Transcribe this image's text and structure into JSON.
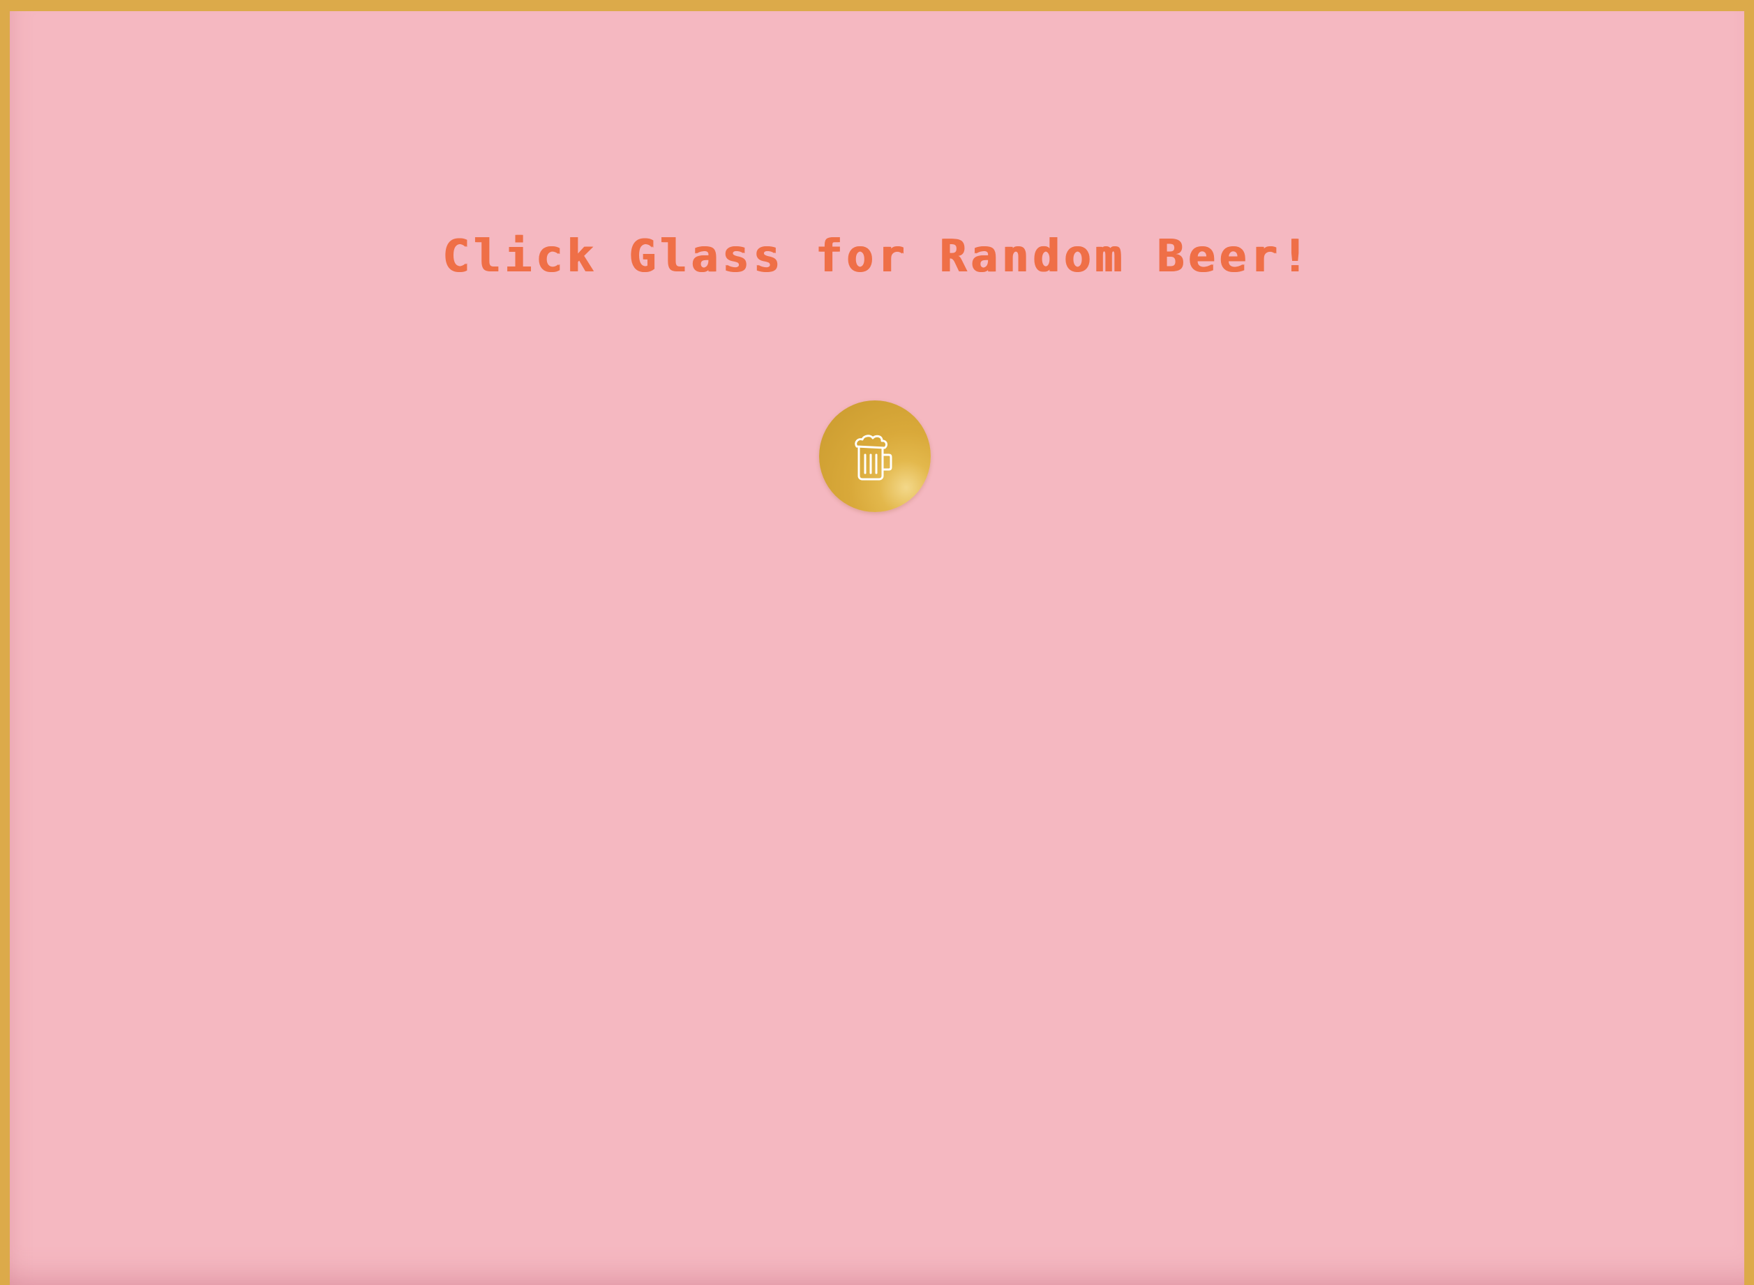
{
  "page": {
    "headline": "Click Glass for Random Beer!"
  },
  "button": {
    "icon": "beer-mug-icon",
    "aria_label": "Random beer"
  },
  "colors": {
    "border": "#dcaa4a",
    "background": "#f5b8c1",
    "headline": "#ef6f47",
    "button": "#d9a93a",
    "icon": "#ffffff"
  }
}
